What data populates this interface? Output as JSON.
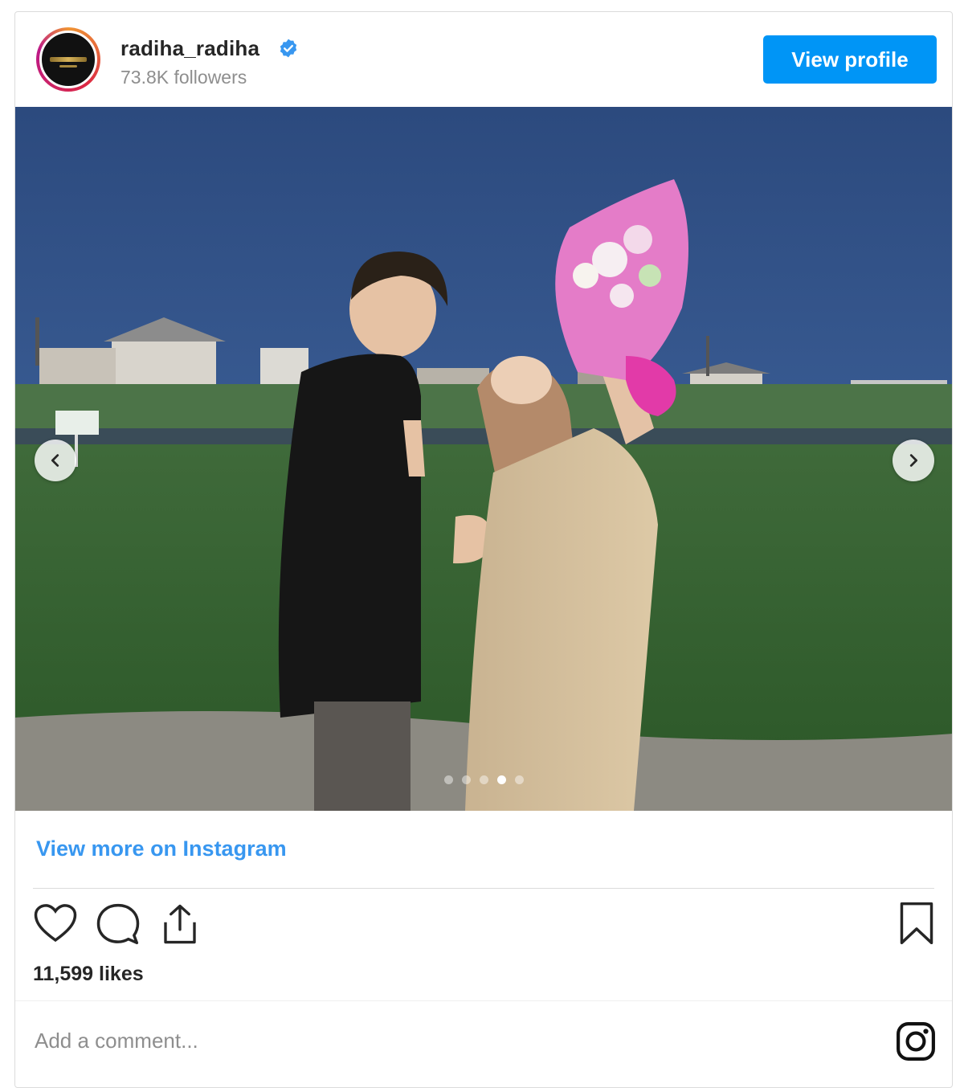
{
  "header": {
    "username": "radiha_radiha",
    "verified": true,
    "followers": "73.8K followers",
    "view_profile_label": "View profile"
  },
  "post": {
    "carousel": {
      "total_slides": 5,
      "active_index": 3
    },
    "view_more_label": "View more on Instagram",
    "likes": "11,599 likes",
    "comment_placeholder": "Add a comment..."
  },
  "icons": {
    "avatar": "brand-logo-avatar",
    "verified": "verified-badge-icon",
    "prev": "chevron-left-icon",
    "next": "chevron-right-icon",
    "like": "heart-icon",
    "comment": "comment-bubble-icon",
    "share": "share-icon",
    "save": "bookmark-icon",
    "instagram": "instagram-logo-icon"
  },
  "colors": {
    "accent": "#0095f6",
    "link": "#3897f0",
    "text": "#262626",
    "muted": "#8e8e8e"
  }
}
